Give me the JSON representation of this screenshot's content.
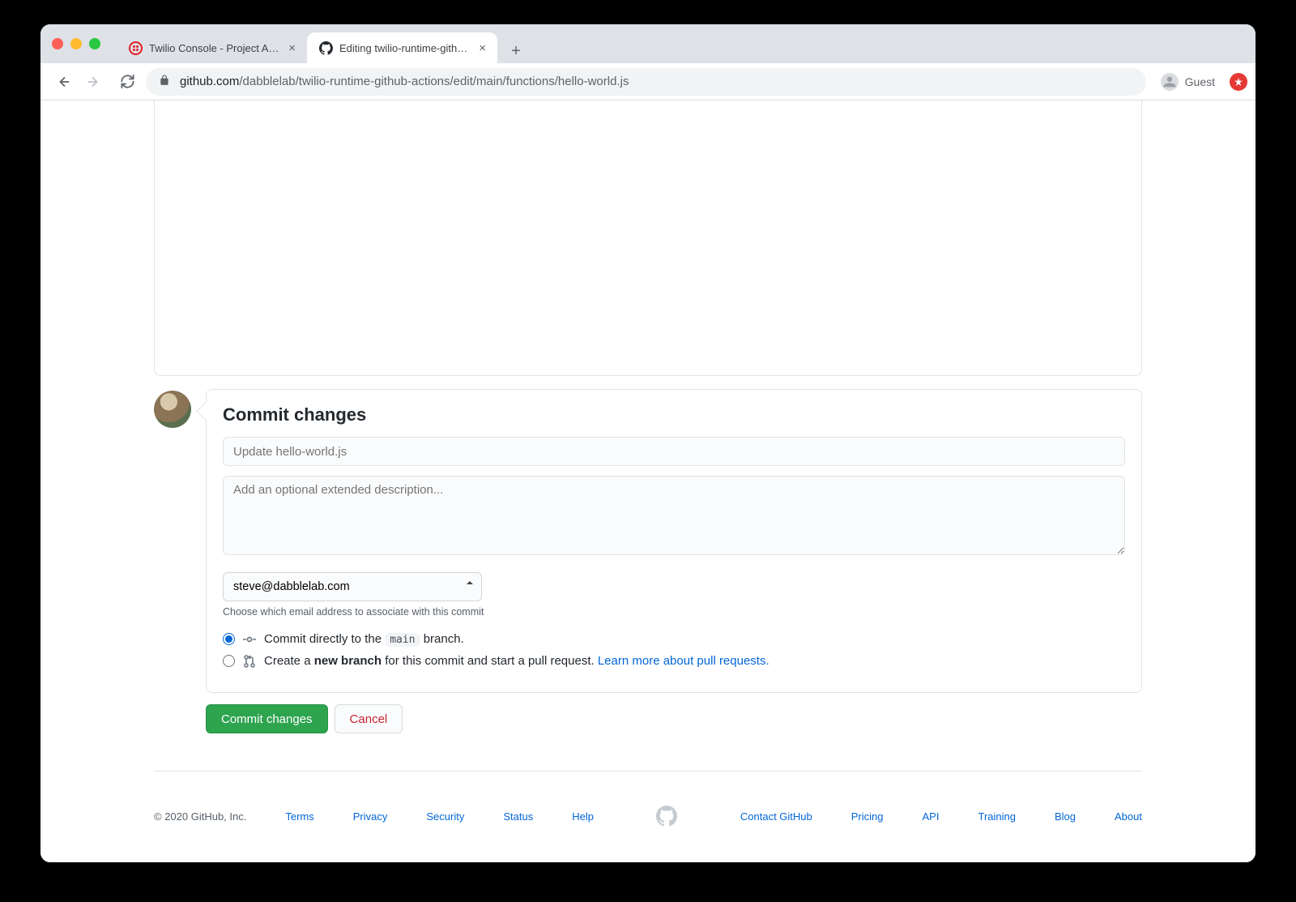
{
  "browser": {
    "tabs": [
      {
        "title": "Twilio Console - Project API Ke",
        "active": false
      },
      {
        "title": "Editing twilio-runtime-github-a",
        "active": true
      }
    ],
    "guest_label": "Guest",
    "url_host": "github.com",
    "url_path": "/dabblelab/twilio-runtime-github-actions/edit/main/functions/hello-world.js"
  },
  "commit": {
    "heading": "Commit changes",
    "message_placeholder": "Update hello-world.js",
    "description_placeholder": "Add an optional extended description...",
    "email_value": "steve@dabblelab.com",
    "email_hint": "Choose which email address to associate with this commit",
    "radio_direct_prefix": "Commit directly to the ",
    "radio_direct_branch": "main",
    "radio_direct_suffix": " branch.",
    "radio_branch_prefix": "Create a ",
    "radio_branch_bold": "new branch",
    "radio_branch_middle": " for this commit and start a pull request. ",
    "radio_branch_link": "Learn more about pull requests.",
    "commit_button": "Commit changes",
    "cancel_button": "Cancel"
  },
  "footer": {
    "copyright": "© 2020 GitHub, Inc.",
    "left_links": [
      "Terms",
      "Privacy",
      "Security",
      "Status",
      "Help"
    ],
    "right_links": [
      "Contact GitHub",
      "Pricing",
      "API",
      "Training",
      "Blog",
      "About"
    ]
  }
}
